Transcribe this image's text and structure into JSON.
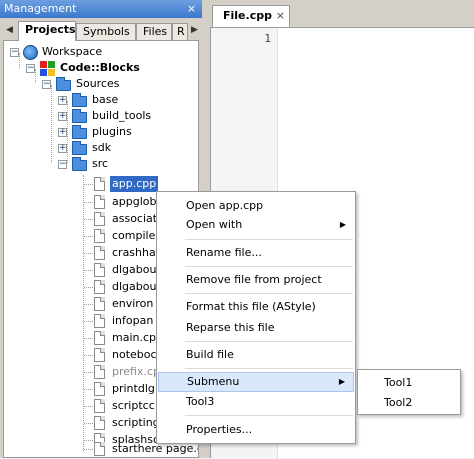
{
  "management": {
    "title": "Management",
    "close_glyph": "×",
    "tabs": [
      {
        "label": "Projects",
        "active": true
      },
      {
        "label": "Symbols",
        "active": false
      },
      {
        "label": "Files",
        "active": false
      },
      {
        "label": "R",
        "active": false
      }
    ],
    "tab_arrows": {
      "left": "◀",
      "right": "▶"
    }
  },
  "tree": {
    "workspace": "Workspace",
    "project": "Code::Blocks",
    "sources": "Sources",
    "folders": [
      "base",
      "build_tools",
      "plugins",
      "sdk",
      "src"
    ],
    "files": [
      "app.cpp",
      "appglob",
      "associat",
      "compile",
      "crashha",
      "dlgabou",
      "dlgabou",
      "environ",
      "infopan",
      "main.cp",
      "noteboc",
      "prefix.cpp",
      "printdlg",
      "scriptcc",
      "scripting",
      "splashsc",
      "starthere page.cpp"
    ]
  },
  "editor": {
    "tab_label": "File.cpp",
    "tab_close": "×",
    "line_number": "1"
  },
  "context_menu": {
    "items": [
      {
        "label": "Open app.cpp"
      },
      {
        "label": "Open with"
      },
      {
        "label": "Rename file..."
      },
      {
        "label": "Remove file from project"
      },
      {
        "label": "Format this file (AStyle)"
      },
      {
        "label": "Reparse this file"
      },
      {
        "label": "Build file"
      },
      {
        "label": "Submenu"
      },
      {
        "label": "Tool3"
      },
      {
        "label": "Properties..."
      }
    ],
    "submenu_arrow": "▶"
  },
  "submenu": {
    "items": [
      {
        "label": "Tool1"
      },
      {
        "label": "Tool2"
      }
    ]
  },
  "colors": {
    "selection": "#316ac5",
    "menu_hover": "#d9e8fb",
    "titlebar": "#3b78cc"
  },
  "icons": [
    "workspace-icon",
    "project-icon",
    "folder-icon",
    "file-icon",
    "expander-icon",
    "close-icon",
    "submenu-arrow-icon"
  ]
}
